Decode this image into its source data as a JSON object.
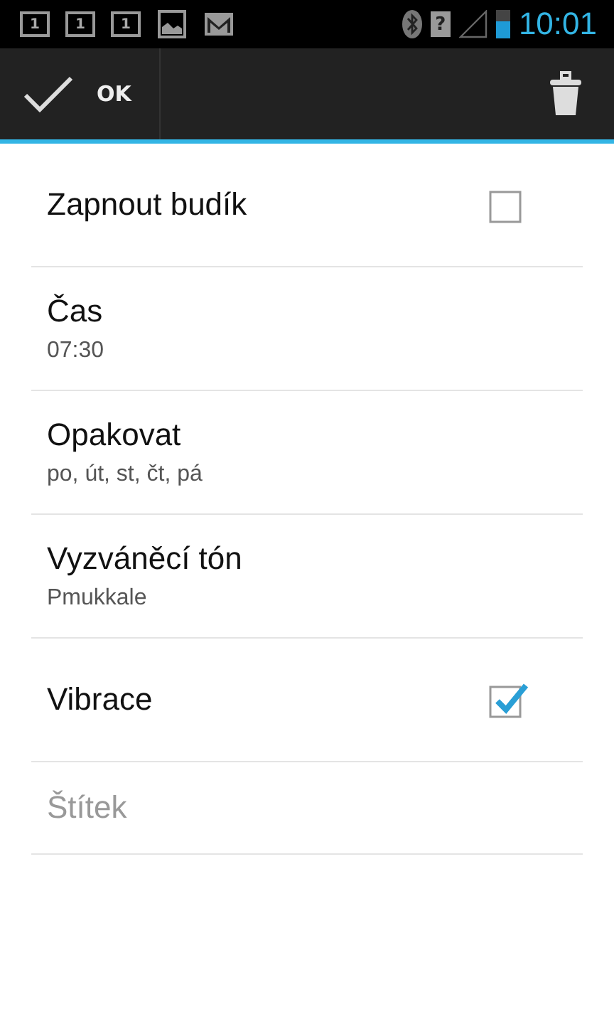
{
  "status_bar": {
    "notifications": [
      {
        "kind": "counter",
        "text": "1"
      },
      {
        "kind": "counter",
        "text": "1"
      },
      {
        "kind": "counter",
        "text": "1"
      },
      {
        "kind": "picture"
      },
      {
        "kind": "mail"
      }
    ],
    "sim_text": "?",
    "time": "10:01"
  },
  "action_bar": {
    "ok_label": "OK"
  },
  "rows": [
    {
      "kind": "checkbox",
      "title": "Zapnout budík",
      "checked": false
    },
    {
      "kind": "detail",
      "title": "Čas",
      "summary": "07:30"
    },
    {
      "kind": "detail",
      "title": "Opakovat",
      "summary": "po, út, st, čt, pá"
    },
    {
      "kind": "detail",
      "title": "Vyzváněcí tón",
      "summary": "Pmukkale"
    },
    {
      "kind": "checkbox",
      "title": "Vibrace",
      "checked": true
    },
    {
      "kind": "field",
      "placeholder": "Štítek"
    }
  ]
}
